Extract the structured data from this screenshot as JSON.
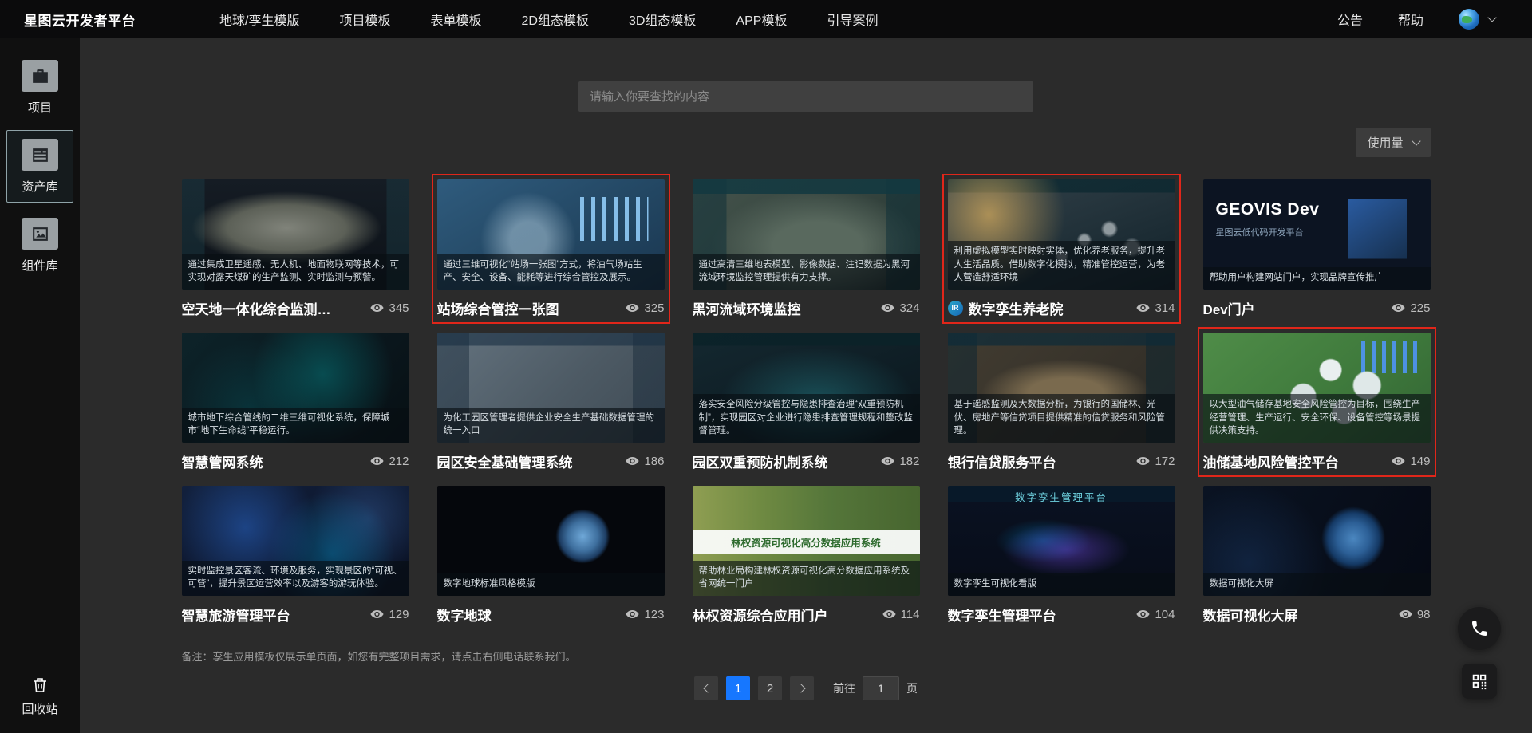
{
  "topnav": {
    "logo": "星图云开发者平台",
    "items": [
      "地球/孪生模版",
      "项目模板",
      "表单模板",
      "2D组态模板",
      "3D组态模板",
      "APP模板",
      "引导案例"
    ],
    "right": [
      "公告",
      "帮助"
    ]
  },
  "sidebar": {
    "items": [
      {
        "label": "项目"
      },
      {
        "label": "资产库"
      },
      {
        "label": "组件库"
      }
    ],
    "recycle_label": "回收站"
  },
  "search": {
    "placeholder": "请输入你要查找的内容"
  },
  "sort": {
    "value": "使用量"
  },
  "cards": [
    {
      "title": "空天地一体化综合监测…",
      "views": "345",
      "desc": "通过集成卫星遥感、无人机、地面物联网等技术，可实现对露天煤矿的生产监测、实时监测与预警。",
      "highlight": false
    },
    {
      "title": "站场综合管控一张图",
      "views": "325",
      "desc": "通过三维可视化“站场一张图”方式，将油气场站生产、安全、设备、能耗等进行综合管控及展示。",
      "highlight": true
    },
    {
      "title": "黑河流域环境监控",
      "views": "324",
      "desc": "通过高清三维地表模型、影像数据、注记数据为黑河流域环境监控管理提供有力支撑。",
      "highlight": false
    },
    {
      "title": "数字孪生养老院",
      "views": "314",
      "desc": "利用虚拟模型实时映射实体，优化养老服务，提升老人生活品质。借助数字化模拟，精准管控运营，为老人营造舒适环境",
      "highlight": true,
      "badge": "IR"
    },
    {
      "title": "Dev门户",
      "views": "225",
      "desc": "帮助用户构建网站门户，实现品牌宣传推广",
      "highlight": false,
      "thumb_title": "GEOVIS Dev",
      "thumb_sub": "星图云低代码开发平台"
    },
    {
      "title": "智慧管网系统",
      "views": "212",
      "desc": "城市地下综合管线的二维三维可视化系统，保障城市“地下生命线”平稳运行。",
      "highlight": false
    },
    {
      "title": "园区安全基础管理系统",
      "views": "186",
      "desc": "为化工园区管理者提供企业安全生产基础数据管理的统一入口",
      "highlight": false
    },
    {
      "title": "园区双重预防机制系统",
      "views": "182",
      "desc": "落实安全风险分级管控与隐患排查治理“双重预防机制”，实现园区对企业进行隐患排查管理规程和整改监督管理。",
      "highlight": false
    },
    {
      "title": "银行信贷服务平台",
      "views": "172",
      "desc": "基于遥感监测及大数据分析，为银行的国储林、光伏、房地产等信贷项目提供精准的信贷服务和风险管理。",
      "highlight": false
    },
    {
      "title": "油储基地风险管控平台",
      "views": "149",
      "desc": "以大型油气储存基地安全风险管控为目标，围绕生产经营管理、生产运行、安全环保、设备管控等场景提供决策支持。",
      "highlight": true
    },
    {
      "title": "智慧旅游管理平台",
      "views": "129",
      "desc": "实时监控景区客流、环境及服务，实现景区的“可视、可管”，提升景区运营效率以及游客的游玩体验。",
      "highlight": false
    },
    {
      "title": "数字地球",
      "views": "123",
      "desc": "数字地球标准风格模版",
      "highlight": false
    },
    {
      "title": "林权资源综合应用门户",
      "views": "114",
      "desc": "帮助林业局构建林权资源可视化高分数据应用系统及省网统一门户",
      "highlight": false,
      "thumb_title": "林权资源可视化高分数据应用系统"
    },
    {
      "title": "数字孪生管理平台",
      "views": "104",
      "desc": "数字孪生可视化看版",
      "highlight": false,
      "thumb_title": "数字孪生管理平台"
    },
    {
      "title": "数据可视化大屏",
      "views": "98",
      "desc": "数据可视化大屏",
      "highlight": false
    }
  ],
  "note": "备注：孪生应用模板仅展示单页面，如您有完整项目需求，请点击右侧电话联系我们。",
  "pagination": {
    "pages": [
      "1",
      "2"
    ],
    "active": "1",
    "goto_label": "前往",
    "goto_value": "1",
    "unit_label": "页"
  },
  "colors": {
    "accent": "#1677ff",
    "highlight": "#e0261a"
  }
}
